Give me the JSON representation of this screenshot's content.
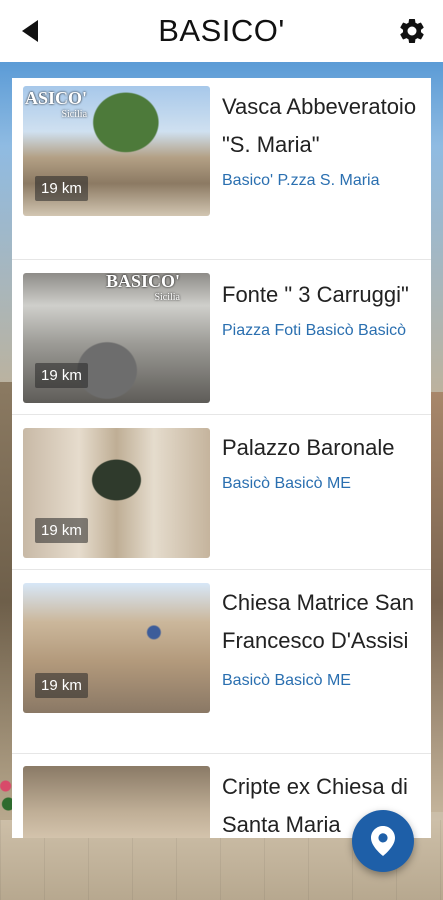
{
  "header": {
    "title": "BASICO'",
    "back_icon": "back-arrow-icon",
    "settings_icon": "gear-icon"
  },
  "places": [
    {
      "name": "Vasca Abbeveratoio \"S. Maria\"",
      "address": "Basico' P.zza S. Maria",
      "distance": "19 km",
      "watermark": "ASICO'",
      "watermark_sub": "Sicilia"
    },
    {
      "name": "Fonte \" 3 Carruggi\"",
      "address": "Piazza Foti Basicò Basicò",
      "distance": "19 km",
      "watermark": "BASICO'",
      "watermark_sub": "Sicilia"
    },
    {
      "name": "Palazzo Baronale",
      "address": "Basicò Basicò ME",
      "distance": "19 km"
    },
    {
      "name": "Chiesa Matrice San Francesco D'Assisi",
      "address": "Basicò Basicò ME",
      "distance": "19 km"
    },
    {
      "name": "Cripte ex Chiesa di Santa Maria",
      "address": "",
      "distance": ""
    }
  ],
  "fab": {
    "icon": "map-pin-icon"
  },
  "colors": {
    "accent": "#1e5fa8",
    "link": "#2a6fb0"
  }
}
